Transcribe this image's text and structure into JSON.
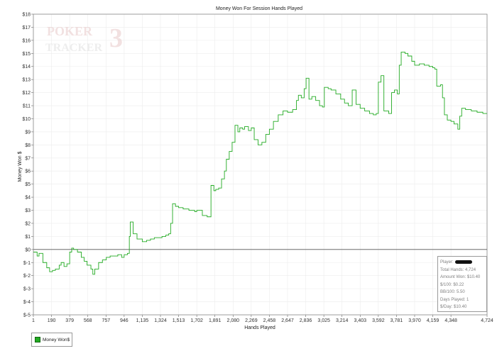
{
  "chart_data": {
    "type": "line",
    "title": "Money Won For Session Hands Played",
    "xlabel": "Hands Played",
    "ylabel": "Money Won $",
    "xlim": [
      1,
      4724
    ],
    "ylim": [
      -5,
      18
    ],
    "x_ticks": [
      "1",
      "190",
      "379",
      "568",
      "757",
      "946",
      "1,135",
      "1,324",
      "1,513",
      "1,702",
      "1,891",
      "2,080",
      "2,269",
      "2,458",
      "2,647",
      "2,836",
      "3,025",
      "3,214",
      "3,403",
      "3,592",
      "3,781",
      "3,970",
      "4,159",
      "4,348",
      "4,724"
    ],
    "y_ticks": [
      "$18",
      "$17",
      "$16",
      "$15",
      "$14",
      "$13",
      "$12",
      "$11",
      "$10",
      "$9",
      "$8",
      "$7",
      "$6",
      "$5",
      "$4",
      "$3",
      "$2",
      "$1",
      "$0",
      "$-1",
      "$-2",
      "$-3",
      "$-4",
      "$-5"
    ],
    "grid": true,
    "series": [
      {
        "name": "Money Won$",
        "color": "#22aa22",
        "points": [
          [
            1,
            -0.2
          ],
          [
            40,
            -0.5
          ],
          [
            60,
            -0.3
          ],
          [
            100,
            -1.0
          ],
          [
            140,
            -1.4
          ],
          [
            170,
            -1.7
          ],
          [
            200,
            -1.6
          ],
          [
            230,
            -1.5
          ],
          [
            270,
            -1.2
          ],
          [
            290,
            -1.0
          ],
          [
            320,
            -1.3
          ],
          [
            350,
            -1.1
          ],
          [
            379,
            -0.2
          ],
          [
            400,
            0.1
          ],
          [
            420,
            0.0
          ],
          [
            460,
            -0.2
          ],
          [
            500,
            -0.6
          ],
          [
            530,
            -0.9
          ],
          [
            560,
            -1.2
          ],
          [
            600,
            -1.5
          ],
          [
            620,
            -1.9
          ],
          [
            640,
            -1.5
          ],
          [
            680,
            -1.0
          ],
          [
            720,
            -0.8
          ],
          [
            760,
            -0.6
          ],
          [
            800,
            -0.5
          ],
          [
            840,
            -0.5
          ],
          [
            880,
            -0.4
          ],
          [
            920,
            -0.6
          ],
          [
            946,
            -0.4
          ],
          [
            980,
            -0.3
          ],
          [
            1000,
            1.0
          ],
          [
            1010,
            2.1
          ],
          [
            1040,
            1.2
          ],
          [
            1080,
            0.8
          ],
          [
            1135,
            0.6
          ],
          [
            1180,
            0.7
          ],
          [
            1220,
            0.8
          ],
          [
            1260,
            0.9
          ],
          [
            1300,
            0.9
          ],
          [
            1340,
            1.0
          ],
          [
            1380,
            1.1
          ],
          [
            1410,
            1.2
          ],
          [
            1430,
            2.0
          ],
          [
            1450,
            3.5
          ],
          [
            1480,
            3.3
          ],
          [
            1513,
            3.2
          ],
          [
            1560,
            3.1
          ],
          [
            1620,
            3.0
          ],
          [
            1680,
            2.9
          ],
          [
            1702,
            3.0
          ],
          [
            1760,
            2.6
          ],
          [
            1810,
            2.5
          ],
          [
            1835,
            2.5
          ],
          [
            1850,
            4.9
          ],
          [
            1880,
            4.5
          ],
          [
            1900,
            4.6
          ],
          [
            1930,
            4.7
          ],
          [
            1960,
            5.4
          ],
          [
            1990,
            6.0
          ],
          [
            2010,
            6.9
          ],
          [
            2040,
            7.5
          ],
          [
            2070,
            8.2
          ],
          [
            2100,
            9.5
          ],
          [
            2130,
            9.0
          ],
          [
            2150,
            9.3
          ],
          [
            2180,
            9.2
          ],
          [
            2200,
            9.4
          ],
          [
            2240,
            9.1
          ],
          [
            2269,
            9.3
          ],
          [
            2300,
            8.4
          ],
          [
            2340,
            8.0
          ],
          [
            2380,
            8.2
          ],
          [
            2420,
            8.8
          ],
          [
            2458,
            9.2
          ],
          [
            2500,
            9.8
          ],
          [
            2550,
            10.3
          ],
          [
            2600,
            10.6
          ],
          [
            2647,
            10.5
          ],
          [
            2700,
            10.7
          ],
          [
            2740,
            11.4
          ],
          [
            2760,
            11.8
          ],
          [
            2790,
            11.6
          ],
          [
            2820,
            12.3
          ],
          [
            2840,
            13.1
          ],
          [
            2870,
            11.5
          ],
          [
            2900,
            11.7
          ],
          [
            2940,
            11.4
          ],
          [
            2980,
            11.0
          ],
          [
            3010,
            10.9
          ],
          [
            3030,
            12.4
          ],
          [
            3070,
            12.3
          ],
          [
            3100,
            12.2
          ],
          [
            3150,
            11.9
          ],
          [
            3200,
            11.5
          ],
          [
            3240,
            11.2
          ],
          [
            3280,
            11.0
          ],
          [
            3320,
            12.2
          ],
          [
            3360,
            11.1
          ],
          [
            3403,
            10.8
          ],
          [
            3450,
            10.6
          ],
          [
            3500,
            10.4
          ],
          [
            3540,
            10.3
          ],
          [
            3570,
            10.4
          ],
          [
            3592,
            12.8
          ],
          [
            3620,
            13.3
          ],
          [
            3650,
            10.6
          ],
          [
            3700,
            10.4
          ],
          [
            3730,
            12.0
          ],
          [
            3760,
            12.2
          ],
          [
            3790,
            11.9
          ],
          [
            3810,
            14.1
          ],
          [
            3830,
            15.1
          ],
          [
            3870,
            15.0
          ],
          [
            3900,
            14.8
          ],
          [
            3940,
            14.4
          ],
          [
            3970,
            14.1
          ],
          [
            4020,
            14.2
          ],
          [
            4070,
            14.1
          ],
          [
            4120,
            14.0
          ],
          [
            4159,
            13.9
          ],
          [
            4180,
            13.8
          ],
          [
            4200,
            12.5
          ],
          [
            4240,
            12.6
          ],
          [
            4260,
            11.6
          ],
          [
            4280,
            10.3
          ],
          [
            4310,
            9.9
          ],
          [
            4348,
            9.8
          ],
          [
            4380,
            9.6
          ],
          [
            4420,
            9.2
          ],
          [
            4440,
            10.2
          ],
          [
            4460,
            10.8
          ],
          [
            4500,
            10.7
          ],
          [
            4560,
            10.6
          ],
          [
            4620,
            10.5
          ],
          [
            4680,
            10.4
          ],
          [
            4724,
            10.4
          ]
        ]
      }
    ]
  },
  "watermark": {
    "line1": "POKER",
    "line2": "TRACKER",
    "digit": "3"
  },
  "stats": {
    "player_label": "Player:",
    "total_hands": "Total Hands: 4,724",
    "amount_won": "Amount Won: $10.40",
    "per_100": "$/100: $0.22",
    "bb_100": "BB/100: 5.50",
    "days_played": "Days Played: 1",
    "per_day": "$/Day: $10.40"
  },
  "legend": {
    "label": "Money Won$"
  }
}
